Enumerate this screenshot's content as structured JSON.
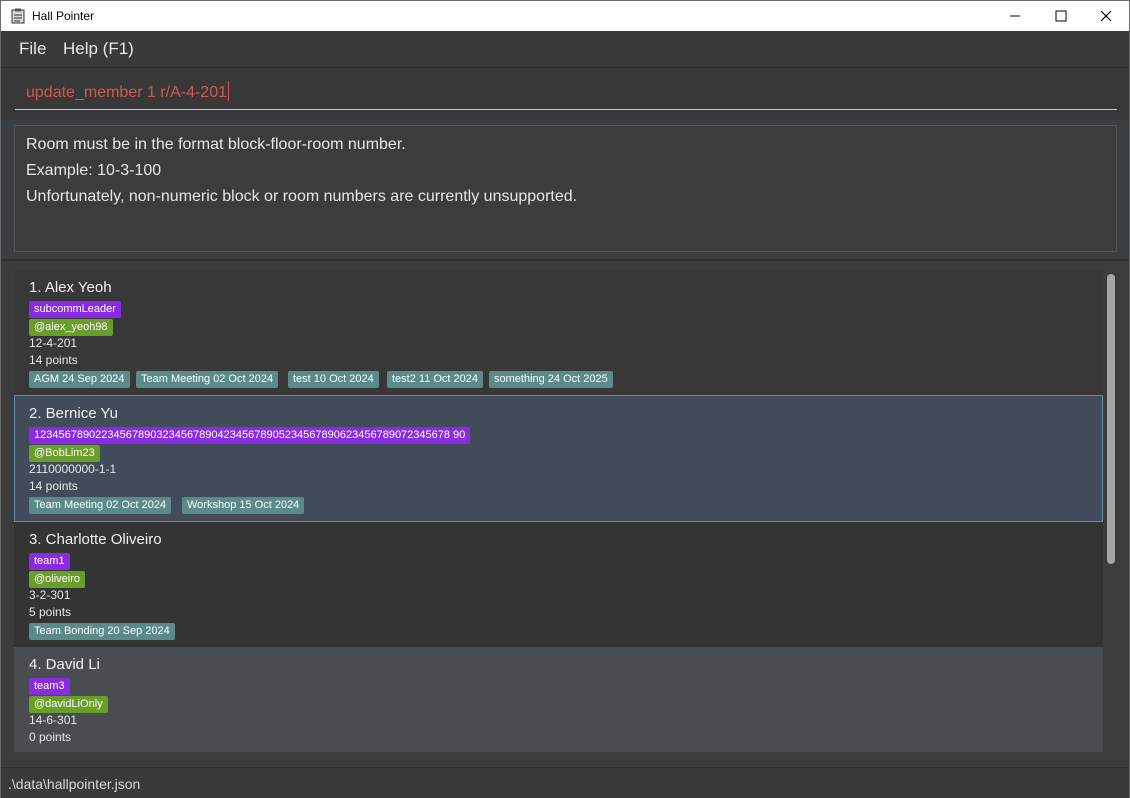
{
  "window": {
    "title": "Hall Pointer"
  },
  "menu": {
    "file": "File",
    "help": "Help (F1)"
  },
  "command": {
    "value": "update_member 1 r/A-4-201"
  },
  "result": {
    "lines": [
      "Room must be in the format block-floor-room number.",
      "Example: 10-3-100",
      "Unfortunately, non-numeric block or room numbers are currently unsupported."
    ]
  },
  "members": [
    {
      "name": "1. Alex Yeoh",
      "role": "subcommLeader",
      "telegram": "@alex_yeoh98",
      "room": "12-4-201",
      "points": "14 points",
      "sessions": [
        "AGM 24 Sep 2024",
        "Team Meeting 02 Oct 2024",
        "test 10 Oct 2024",
        "test2 11 Oct 2024",
        "something 24 Oct 2025"
      ]
    },
    {
      "name": "2. Bernice Yu",
      "role": "12345678902234567890323456789042345678905234567890623456789072345678 90",
      "telegram": "@BobLim23",
      "room": "2110000000-1-1",
      "points": "14 points",
      "sessions": [
        "Team Meeting 02 Oct 2024",
        "Workshop 15 Oct 2024"
      ]
    },
    {
      "name": "3. Charlotte Oliveiro",
      "role": "team1",
      "telegram": "@oliveiro",
      "room": "3-2-301",
      "points": "5 points",
      "sessions": [
        "Team Bonding 20 Sep 2024"
      ]
    },
    {
      "name": "4. David Li",
      "role": "team3",
      "telegram": "@davidLiOnly",
      "room": "14-6-301",
      "points": "0 points",
      "sessions": []
    }
  ],
  "status": {
    "path": ".\\data\\hallpointer.json"
  },
  "icons": {
    "app": "clipboard-icon",
    "minimize": "minimize-icon",
    "maximize": "maximize-icon",
    "close": "close-icon"
  },
  "colors": {
    "role_tag": "#8a2be2",
    "telegram_tag": "#6a9e2a",
    "session_tag": "#5a8a8a",
    "selected_card": "#424b5a",
    "command_text": "#d2584f"
  }
}
